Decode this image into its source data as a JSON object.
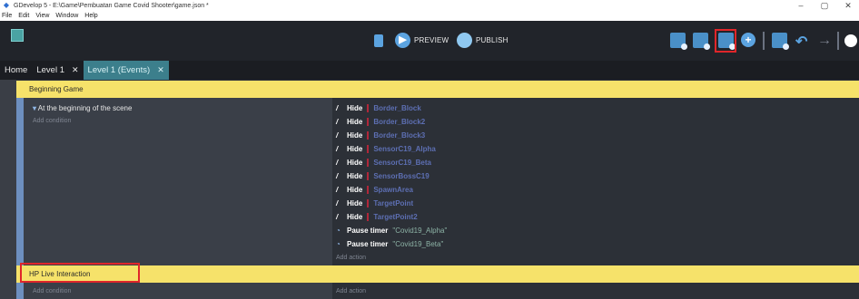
{
  "window": {
    "title": "GDevelop 5 - E:\\Game\\Pembuatan Game Covid Shooter\\game.json *",
    "controls": [
      "–",
      "▢",
      "✕"
    ]
  },
  "menu": [
    "File",
    "Edit",
    "View",
    "Window",
    "Help"
  ],
  "toolbar": {
    "preview_label": "PREVIEW",
    "publish_label": "PUBLISH"
  },
  "tabs": [
    {
      "label": "Home",
      "closable": false
    },
    {
      "label": "Level 1",
      "closable": true
    },
    {
      "label": "Level 1 (Events)",
      "closable": true
    }
  ],
  "events": [
    {
      "group": "Beginning Game",
      "condition": "At the beginning of the scene",
      "add_condition": "Add condition",
      "actions": [
        {
          "verb": "Hide",
          "object": "Border_Block"
        },
        {
          "verb": "Hide",
          "object": "Border_Block2"
        },
        {
          "verb": "Hide",
          "object": "Border_Block3"
        },
        {
          "verb": "Hide",
          "object": "SensorC19_Alpha"
        },
        {
          "verb": "Hide",
          "object": "SensorC19_Beta"
        },
        {
          "verb": "Hide",
          "object": "SensorBossC19"
        },
        {
          "verb": "Hide",
          "object": "SpawnArea"
        },
        {
          "verb": "Hide",
          "object": "TargetPoint"
        },
        {
          "verb": "Hide",
          "object": "TargetPoint2"
        }
      ],
      "timers": [
        {
          "verb": "Pause timer",
          "value": "\"Covid19_Alpha\""
        },
        {
          "verb": "Pause timer",
          "value": "\"Covid19_Beta\""
        }
      ],
      "add_action": "Add action"
    },
    {
      "group": "HP Live Interaction",
      "add_condition": "Add condition",
      "add_action": "Add action"
    }
  ],
  "colors": {
    "header_yellow": "#f6e26a",
    "highlight_red": "#e0262a",
    "active_tab": "#3c7f8c"
  }
}
